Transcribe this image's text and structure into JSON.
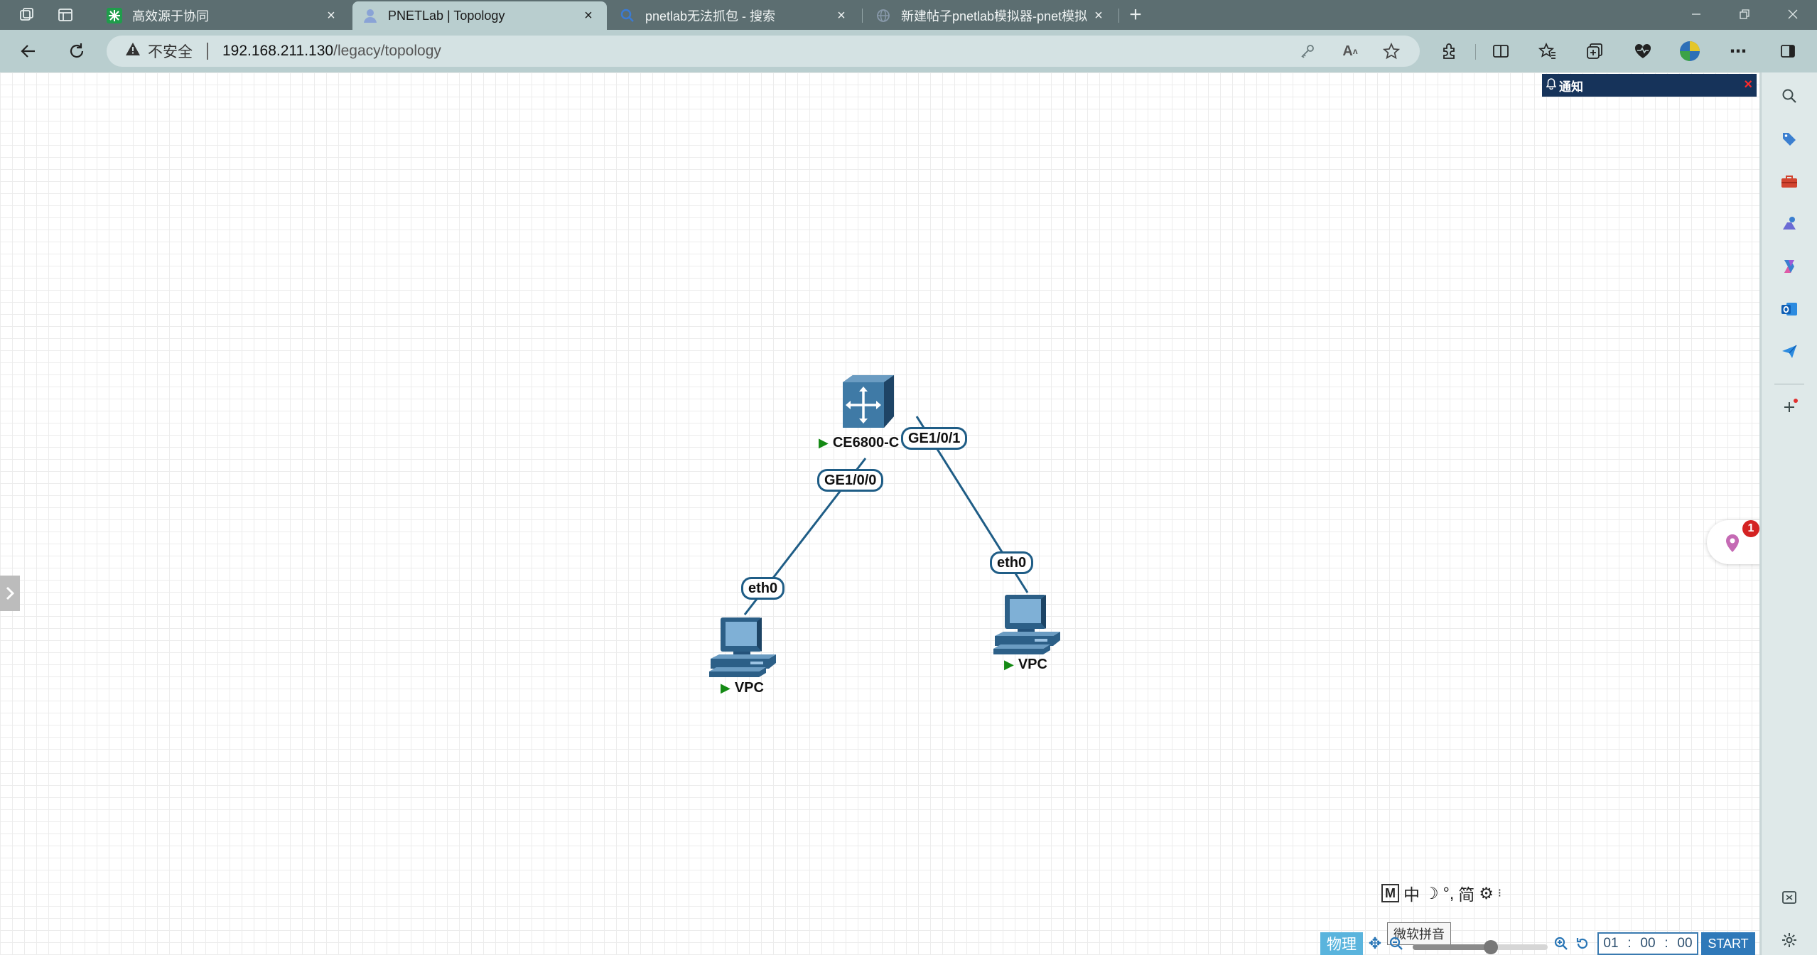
{
  "browser": {
    "tabs": [
      {
        "title": "高效源于协同",
        "favicon": "green-snowflake-icon",
        "active": false
      },
      {
        "title": "PNETLab | Topology",
        "favicon": "pnetlab-person-icon",
        "active": true
      },
      {
        "title": "pnetlab无法抓包 - 搜索",
        "favicon": "bing-search-icon",
        "active": false
      },
      {
        "title": "新建帖子pnetlab模拟器-pnet模拟",
        "favicon": "globe-icon",
        "active": false
      }
    ],
    "close_glyph": "×",
    "new_tab_glyph": "+",
    "address": {
      "security_label": "不安全",
      "url_host": "192.168.211.130",
      "url_path": "/legacy/topology"
    }
  },
  "notification": {
    "title": "通知",
    "close_glyph": "×"
  },
  "topology": {
    "nodes": [
      {
        "label": "CE6800-C",
        "icon": "switch-icon",
        "state": "running"
      },
      {
        "label": "VPC",
        "icon": "pc-icon",
        "state": "running"
      },
      {
        "label": "VPC",
        "icon": "pc-icon",
        "state": "running"
      }
    ],
    "interfaces": {
      "switch_left": "GE1/0/0",
      "switch_right": "GE1/0/1",
      "vpc_left": "eth0",
      "vpc_right": "eth0"
    },
    "play_glyph": "▶"
  },
  "floating_badge": {
    "count": "1"
  },
  "ime": {
    "mode": "M",
    "lang": "中",
    "punct": "°,",
    "script": "简",
    "tooltip": "微软拼音"
  },
  "bottom_controls": {
    "view_label": "物理",
    "timer": {
      "hours": "01",
      "minutes": "00",
      "seconds": "00"
    },
    "start_label": "START",
    "zoom_level": 0.58
  }
}
